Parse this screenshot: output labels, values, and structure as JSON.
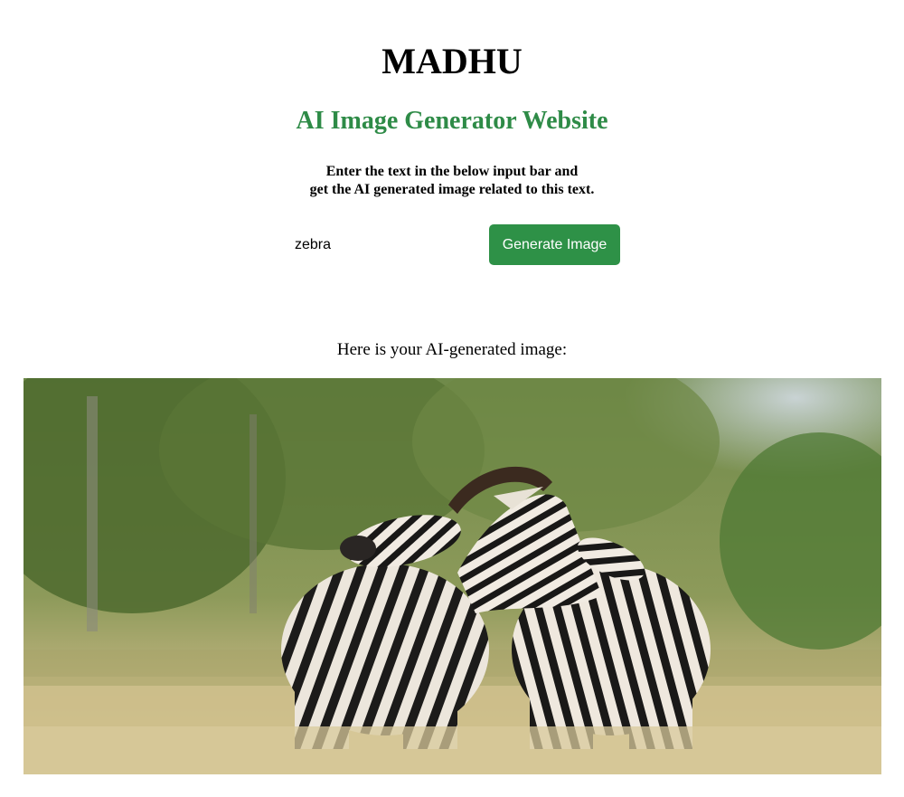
{
  "header": {
    "title": "MADHU",
    "subtitle": "AI Image Generator Website"
  },
  "instructions": {
    "line1": "Enter the text in the below input bar and",
    "line2": "get the AI generated image related to this text."
  },
  "form": {
    "input_value": "zebra",
    "button_label": "Generate Image"
  },
  "result": {
    "caption": "Here is your AI-generated image:"
  },
  "colors": {
    "accent": "#2e8b47",
    "button": "#2e9147"
  }
}
